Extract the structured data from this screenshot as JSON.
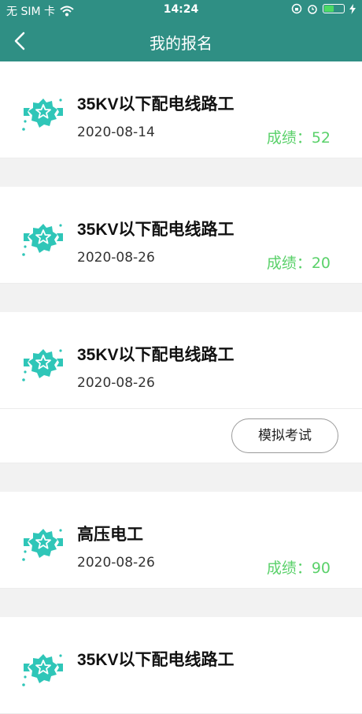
{
  "status_bar": {
    "carrier": "无 SIM 卡",
    "time": "14:24"
  },
  "header": {
    "title": "我的报名"
  },
  "colors": {
    "header": "#2f8f84",
    "score": "#5ad16a",
    "badge": "#2fc6b8"
  },
  "registrations": [
    {
      "title": "35KV以下配电线路工",
      "date": "2020-08-14",
      "score": "成绩：52"
    },
    {
      "title": "35KV以下配电线路工",
      "date": "2020-08-26",
      "score": "成绩：20"
    },
    {
      "title": "35KV以下配电线路工",
      "date": "2020-08-26",
      "button": "模拟考试"
    },
    {
      "title": "高压电工",
      "date": "2020-08-26",
      "score": "成绩：90"
    },
    {
      "title": "35KV以下配电线路工"
    }
  ]
}
